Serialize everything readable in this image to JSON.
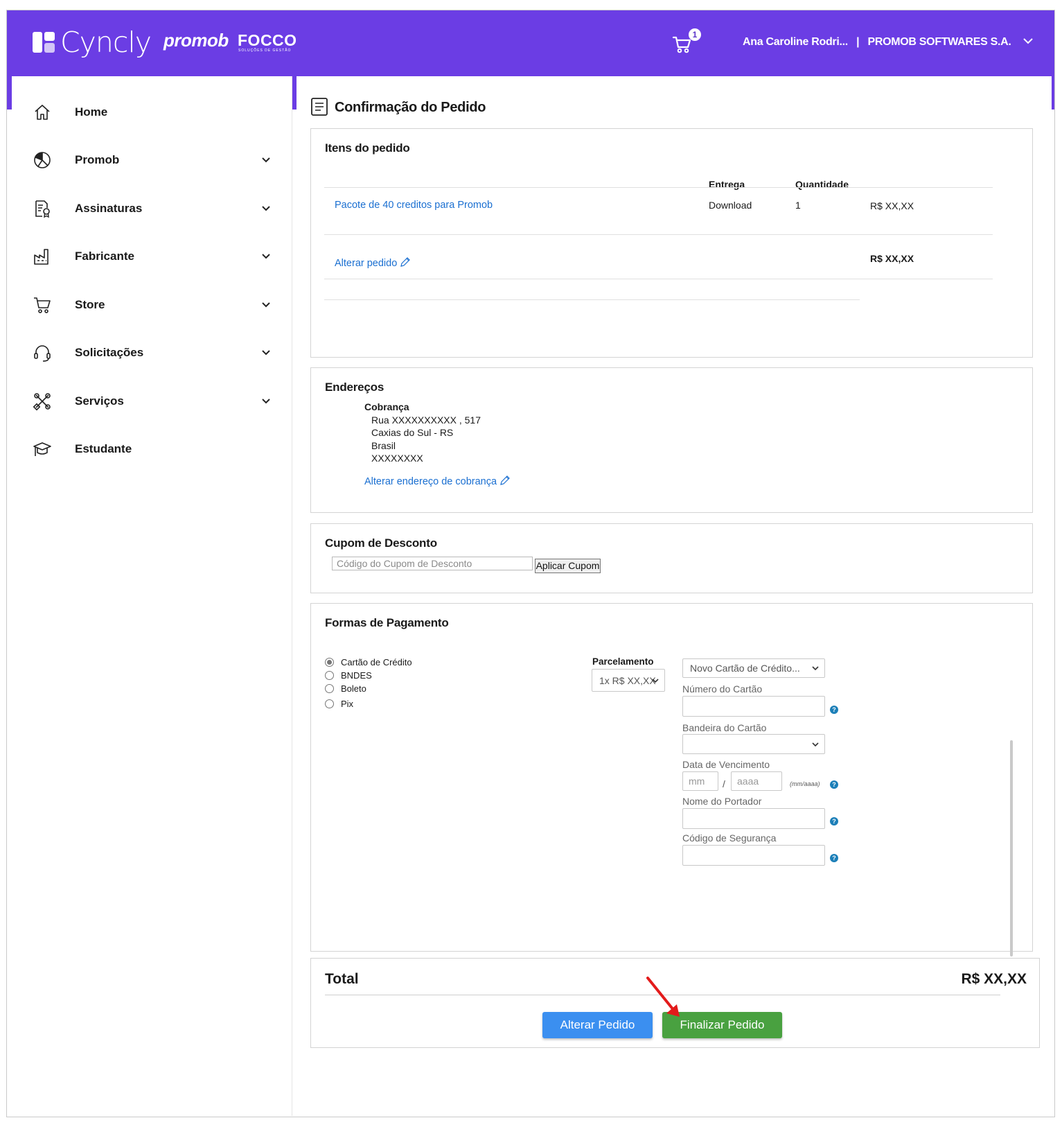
{
  "header": {
    "brand": "Cyncly",
    "brand2": "promob",
    "brand3": "FOCCO",
    "brand3_sub": "SOLUÇÕES DE GESTÃO",
    "cart_count": "1",
    "user_name": "Ana Caroline Rodri...",
    "separator": "|",
    "company": "PROMOB SOFTWARES S.A."
  },
  "sidebar": {
    "items": [
      {
        "label": "Home",
        "icon": "home-icon"
      },
      {
        "label": "Promob",
        "icon": "promob-icon"
      },
      {
        "label": "Assinaturas",
        "icon": "subscriptions-icon"
      },
      {
        "label": "Fabricante",
        "icon": "factory-icon"
      },
      {
        "label": "Store",
        "icon": "cart-icon"
      },
      {
        "label": "Solicitações",
        "icon": "headset-icon"
      },
      {
        "label": "Serviços",
        "icon": "tools-icon"
      },
      {
        "label": "Estudante",
        "icon": "graduation-icon"
      }
    ]
  },
  "page": {
    "title": "Confirmação do Pedido"
  },
  "items": {
    "title": "Itens do pedido",
    "col_delivery": "Entrega",
    "col_quantity": "Quantidade",
    "rows": [
      {
        "product": "Pacote de 40 creditos para Promob",
        "delivery": "Download",
        "quantity": "1",
        "price": "R$ XX,XX"
      }
    ],
    "edit_link": "Alterar pedido",
    "subtotal": "R$ XX,XX"
  },
  "addresses": {
    "title": "Endereços",
    "billing_title": "Cobrança",
    "line1": "Rua  XXXXXXXXXX , 517",
    "line2": "Caxias do Sul - RS",
    "line3": "Brasil",
    "line4": "XXXXXXXX",
    "edit_link": "Alterar endereço de cobrança"
  },
  "coupon": {
    "title": "Cupom de Desconto",
    "placeholder": "Código do Cupom de Desconto",
    "apply_label": "Aplicar Cupom"
  },
  "payment": {
    "title": "Formas de Pagamento",
    "methods": [
      {
        "label": "Cartão de Crédito",
        "selected": true
      },
      {
        "label": "BNDES",
        "selected": false
      },
      {
        "label": "Boleto",
        "selected": false
      },
      {
        "label": "Pix",
        "selected": false
      }
    ],
    "installments_label": "Parcelamento",
    "installments_value": "1x R$ XX,XX",
    "card_select": "Novo Cartão de Crédito...",
    "card_number_label": "Número do Cartão",
    "card_brand_label": "Bandeira do Cartão",
    "expiry_label": "Data de Vencimento",
    "expiry_month_placeholder": "mm",
    "expiry_sep": "/",
    "expiry_year_placeholder": "aaaa",
    "expiry_hint": "(mm/aaaa)",
    "holder_label": "Nome do Portador",
    "security_label": "Código de Segurança",
    "help_glyph": "?"
  },
  "total": {
    "label": "Total",
    "value": "R$ XX,XX",
    "edit_button": "Alterar Pedido",
    "finish_button": "Finalizar Pedido"
  },
  "colors": {
    "brand_purple": "#6b3de4",
    "link_blue": "#1a6fd1",
    "button_blue": "#3b8ff0",
    "button_green": "#49a140",
    "annotation_red": "#e31b1b"
  }
}
